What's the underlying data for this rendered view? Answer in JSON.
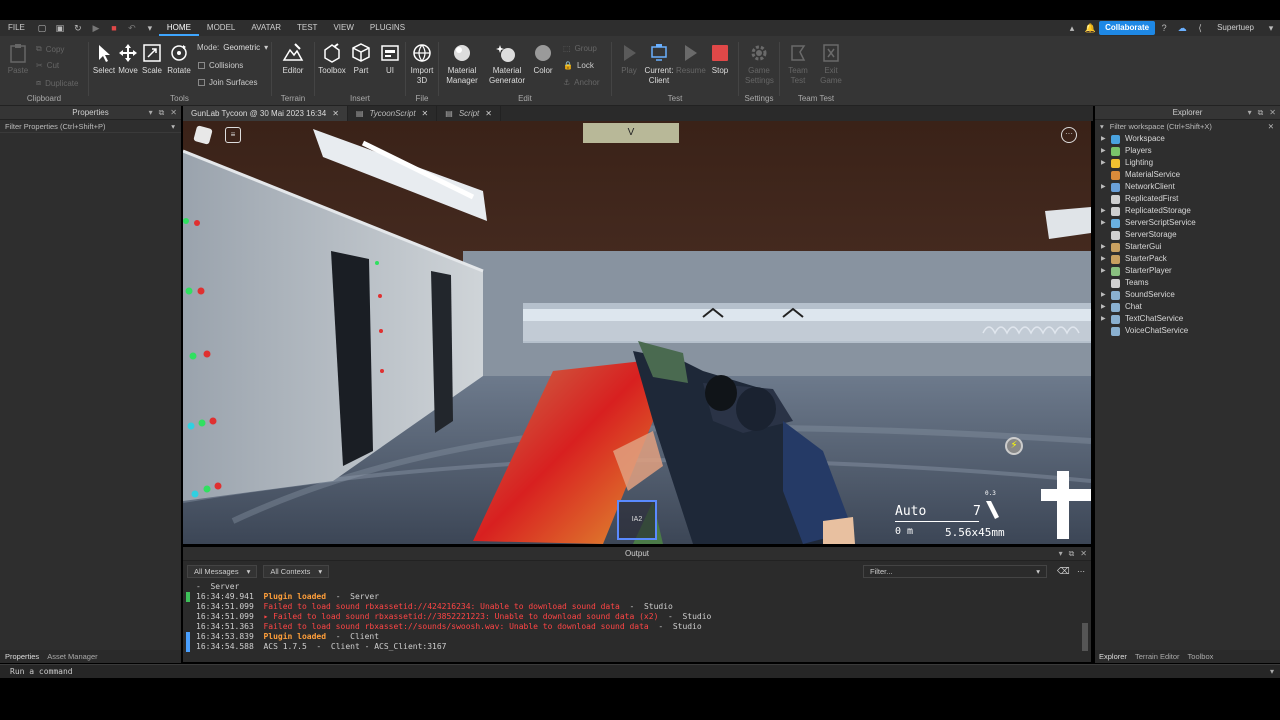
{
  "menu": {
    "file": "FILE",
    "tabs": [
      "HOME",
      "MODEL",
      "AVATAR",
      "TEST",
      "VIEW",
      "PLUGINS"
    ],
    "collaborate": "Collaborate",
    "user": "Supertuep"
  },
  "ribbon": {
    "clipboard": {
      "label": "Clipboard",
      "paste": "Paste",
      "copy": "Copy",
      "cut": "Cut",
      "duplicate": "Duplicate"
    },
    "tools": {
      "label": "Tools",
      "select": "Select",
      "move": "Move",
      "scale": "Scale",
      "rotate": "Rotate",
      "mode_label": "Mode:",
      "mode_value": "Geometric",
      "collisions": "Collisions",
      "join_surfaces": "Join Surfaces"
    },
    "terrain": {
      "label": "Terrain",
      "editor": "Editor"
    },
    "insert": {
      "label": "Insert",
      "toolbox": "Toolbox",
      "part": "Part",
      "ui": "UI"
    },
    "file": {
      "label": "File",
      "import": "Import",
      "import2": "3D"
    },
    "edit": {
      "label": "Edit",
      "material_manager": "Material",
      "material_manager2": "Manager",
      "material_generator": "Material",
      "material_generator2": "Generator",
      "color": "Color",
      "group": "Group",
      "lock": "Lock",
      "anchor": "Anchor"
    },
    "test": {
      "label": "Test",
      "play": "Play",
      "current_client": "Current:",
      "current_client2": "Client",
      "resume": "Resume",
      "stop": "Stop"
    },
    "settings": {
      "label": "Settings",
      "game_settings": "Game",
      "game_settings2": "Settings"
    },
    "team_test": {
      "label": "Team Test",
      "team_test": "Team",
      "team_test2": "Test",
      "exit_game": "Exit",
      "exit_game2": "Game"
    }
  },
  "properties": {
    "title": "Properties",
    "filter": "Filter Properties (Ctrl+Shift+P)"
  },
  "doc_tabs": [
    {
      "label": "GunLab Tycoon @ 30 Mai 2023 16:34"
    },
    {
      "label": "TycoonScript"
    },
    {
      "label": "Script"
    }
  ],
  "viewport": {
    "top_key": "V",
    "hud_mode": "Auto",
    "hud_ammo": "7",
    "hud_range": "0 m",
    "hud_caliber": "5.56x45mm",
    "hud_slot": "IA2",
    "hud_small": "0.3"
  },
  "explorer": {
    "title": "Explorer",
    "filter": "Filter workspace (Ctrl+Shift+X)",
    "items": [
      {
        "name": "Workspace",
        "color": "#4aa3df",
        "arrow": true
      },
      {
        "name": "Players",
        "color": "#7ac36a",
        "arrow": true
      },
      {
        "name": "Lighting",
        "color": "#f0c030",
        "arrow": true
      },
      {
        "name": "MaterialService",
        "color": "#d88a3a",
        "arrow": false
      },
      {
        "name": "NetworkClient",
        "color": "#6aa0d8",
        "arrow": true
      },
      {
        "name": "ReplicatedFirst",
        "color": "#d0d0d0",
        "arrow": false
      },
      {
        "name": "ReplicatedStorage",
        "color": "#d0d0d0",
        "arrow": true
      },
      {
        "name": "ServerScriptService",
        "color": "#6ab0e0",
        "arrow": true
      },
      {
        "name": "ServerStorage",
        "color": "#d0d0d0",
        "arrow": false
      },
      {
        "name": "StarterGui",
        "color": "#c8a060",
        "arrow": true
      },
      {
        "name": "StarterPack",
        "color": "#c8a060",
        "arrow": true
      },
      {
        "name": "StarterPlayer",
        "color": "#8ac080",
        "arrow": true
      },
      {
        "name": "Teams",
        "color": "#d0d0d0",
        "arrow": false
      },
      {
        "name": "SoundService",
        "color": "#8ab0d0",
        "arrow": true
      },
      {
        "name": "Chat",
        "color": "#8ab0d0",
        "arrow": true
      },
      {
        "name": "TextChatService",
        "color": "#8ab0d0",
        "arrow": true
      },
      {
        "name": "VoiceChatService",
        "color": "#8ab0d0",
        "arrow": false
      }
    ]
  },
  "output": {
    "title": "Output",
    "all_messages": "All Messages",
    "all_contexts": "All Contexts",
    "filter": "Filter...",
    "lines": [
      {
        "time": "-",
        "msg": "Server",
        "type": "normal",
        "ctx": ""
      },
      {
        "time": "16:34:49.941",
        "msg": "Plugin loaded",
        "type": "plugin",
        "ctx": "  -  Server"
      },
      {
        "time": "16:34:51.099",
        "msg": "Failed to load sound rbxassetid://424216234: Unable to download sound data",
        "type": "error",
        "ctx": "  -  Studio"
      },
      {
        "time": "16:34:51.099",
        "msg": "▸ Failed to load sound rbxassetid://3852221223: Unable to download sound data (x2)",
        "type": "error",
        "ctx": "  -  Studio"
      },
      {
        "time": "16:34:51.363",
        "msg": "Failed to load sound rbxasset://sounds/swoosh.wav: Unable to download sound data",
        "type": "error",
        "ctx": "  -  Studio"
      },
      {
        "time": "16:34:53.839",
        "msg": "Plugin loaded",
        "type": "plugin",
        "ctx": "  -  Client"
      },
      {
        "time": "16:34:54.588",
        "msg": "ACS 1.7.5",
        "type": "normal",
        "ctx": "  -  Client - ACS_Client:3167"
      }
    ]
  },
  "bottom_tabs_left": [
    "Properties",
    "Asset Manager"
  ],
  "bottom_tabs_right": [
    "Explorer",
    "Terrain Editor",
    "Toolbox"
  ],
  "command_bar": {
    "placeholder": "Run a command"
  },
  "colors": {
    "accent": "#3ea6ff",
    "collaborate": "#1e88e5",
    "stop": "#e04848",
    "plugin": "#ff9f3a",
    "error": "#ff4545"
  }
}
